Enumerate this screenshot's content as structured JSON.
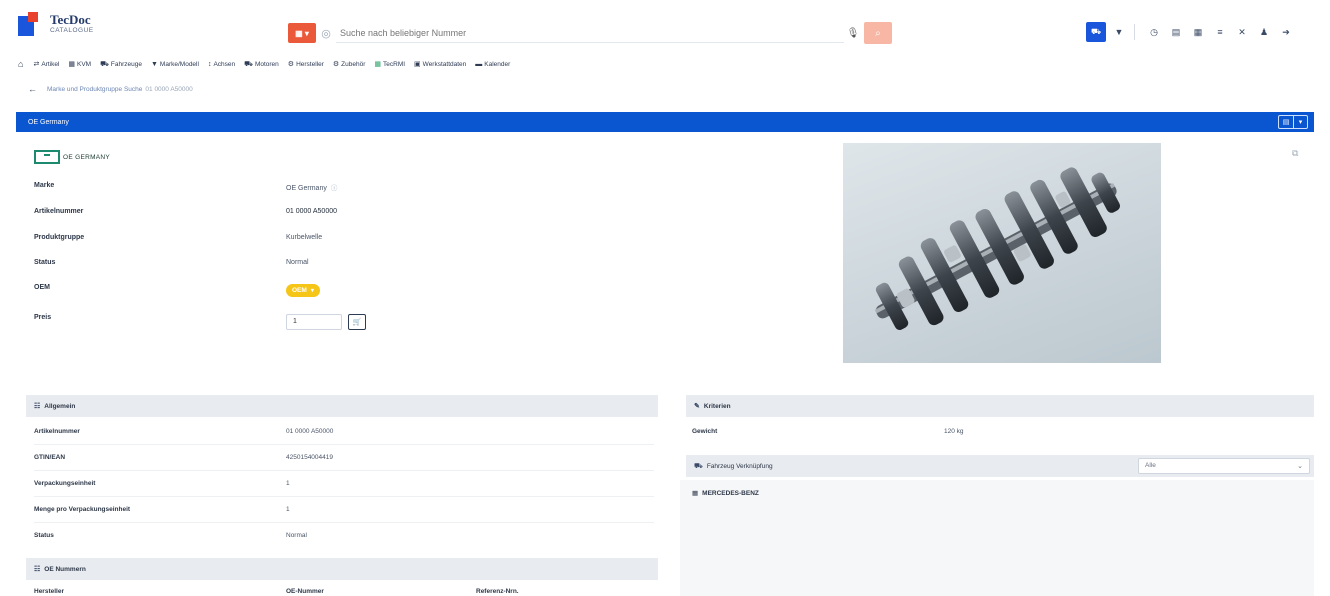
{
  "app": {
    "logo_title": "TecDoc",
    "logo_subtitle": "CATALOGUE"
  },
  "search": {
    "type_label": "▦ ▾",
    "placeholder": "Suche nach beliebiger Nummer",
    "go_label": "⌕"
  },
  "nav": {
    "items": [
      {
        "icon": "⇄",
        "label": "Artikel"
      },
      {
        "icon": "▦",
        "label": "KVM"
      },
      {
        "icon": "⛟",
        "label": "Fahrzeuge"
      },
      {
        "icon": "▼",
        "label": "Marke/Modell"
      },
      {
        "icon": "↕",
        "label": "Achsen"
      },
      {
        "icon": "⛟",
        "label": "Motoren"
      },
      {
        "icon": "⚙",
        "label": "Hersteller"
      },
      {
        "icon": "⚙",
        "label": "Zubehör"
      },
      {
        "icon": "▦",
        "label": "TecRMI"
      },
      {
        "icon": "▣",
        "label": "Werkstattdaten"
      },
      {
        "icon": "▬",
        "label": "Kalender"
      }
    ]
  },
  "breadcrumb": {
    "parent": "Marke und Produktgruppe Suche",
    "current": "01 0000 A50000"
  },
  "header_bar": {
    "title": "OE Germany"
  },
  "brand": {
    "logo_text": "OE GERMANY"
  },
  "details": [
    {
      "label": "Marke",
      "value": "OE Germany"
    },
    {
      "label": "Artikelnummer",
      "value": "01 0000 A50000"
    },
    {
      "label": "Produktgruppe",
      "value": "Kurbelwelle"
    },
    {
      "label": "Status",
      "value": "Normal"
    },
    {
      "label": "OEM",
      "value": "OEM"
    },
    {
      "label": "Preis",
      "value": "1"
    }
  ],
  "sections": {
    "allgemein": {
      "title": "Allgemein",
      "rows": [
        {
          "label": "Artikelnummer",
          "value": "01 0000 A50000"
        },
        {
          "label": "GTIN/EAN",
          "value": "4250154004419"
        },
        {
          "label": "Verpackungseinheit",
          "value": "1"
        },
        {
          "label": "Menge pro Verpackungseinheit",
          "value": "1"
        },
        {
          "label": "Status",
          "value": "Normal"
        }
      ]
    },
    "oe_nummern": {
      "title": "OE Nummern",
      "col1": "Hersteller",
      "col2": "OE-Nummer",
      "col3": "Referenz-Nrn."
    },
    "kriterien": {
      "title": "Kriterien",
      "rows": [
        {
          "label": "Gewicht",
          "value": "120 kg"
        }
      ]
    },
    "verknuepfung": {
      "title": "Fahrzeug Verknüpfung",
      "select_value": "Alle",
      "manufacturer": "MERCEDES-BENZ"
    }
  },
  "colors": {
    "brand_blue": "#0a55d0",
    "accent_orange": "#ea5a3a",
    "badge_yellow": "#f5c518"
  }
}
